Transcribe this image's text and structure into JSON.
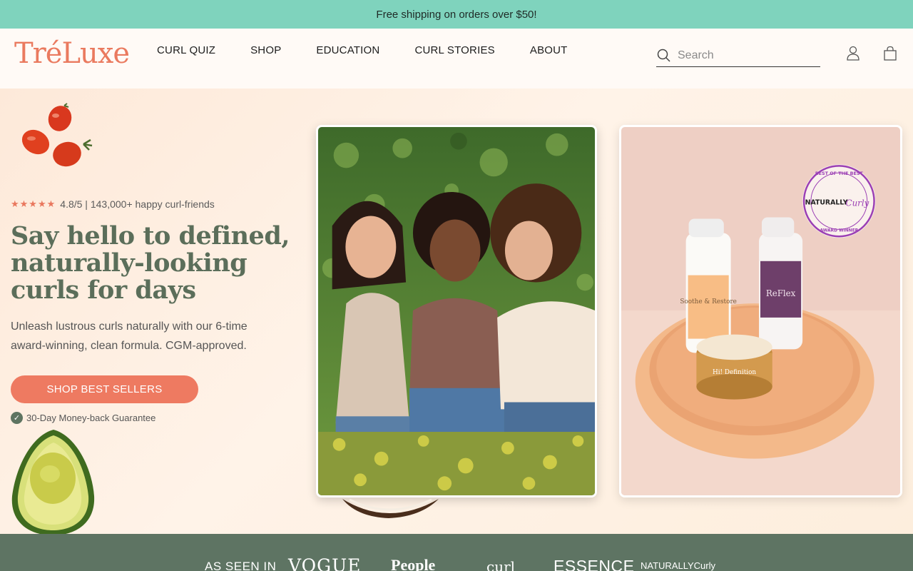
{
  "announcement": {
    "text": "Free shipping on orders over $50!"
  },
  "header": {
    "logo": "TréLuxe",
    "nav": [
      "CURL QUIZ",
      "SHOP",
      "EDUCATION",
      "CURL STORIES",
      "ABOUT"
    ],
    "search_placeholder": "Search",
    "icons": [
      "search-icon",
      "account-icon",
      "cart-icon"
    ]
  },
  "hero": {
    "stars": "★★★★★",
    "rating_text": "4.8/5 | 143,000+ happy curl-friends",
    "title": "Say hello to defined, naturally-looking curls for days",
    "subtitle": "Unleash lustrous curls naturally with our 6-time award-winning, clean formula. CGM-approved.",
    "cta_label": "SHOP BEST SELLERS",
    "guarantee": "30-Day Money-back Guarantee",
    "badge_top": "BEST OF THE BEST",
    "badge_brand": "NATURALLY",
    "badge_brand_script": "Curly",
    "badge_bottom": "AWARD WINNER",
    "product_labels": [
      "Soothe & Restore",
      "ReFlex",
      "Hi! Definition"
    ]
  },
  "press": {
    "label": "AS SEEN IN",
    "logos": [
      "VOGUE",
      "People",
      "curl",
      "ESSENCE",
      "NATURALLYCurly"
    ]
  },
  "colors": {
    "announcement_bg": "#7fd3bd",
    "brand_coral": "#ee7a61",
    "headline_green": "#5b6e5a",
    "press_bg": "#5e7463"
  }
}
